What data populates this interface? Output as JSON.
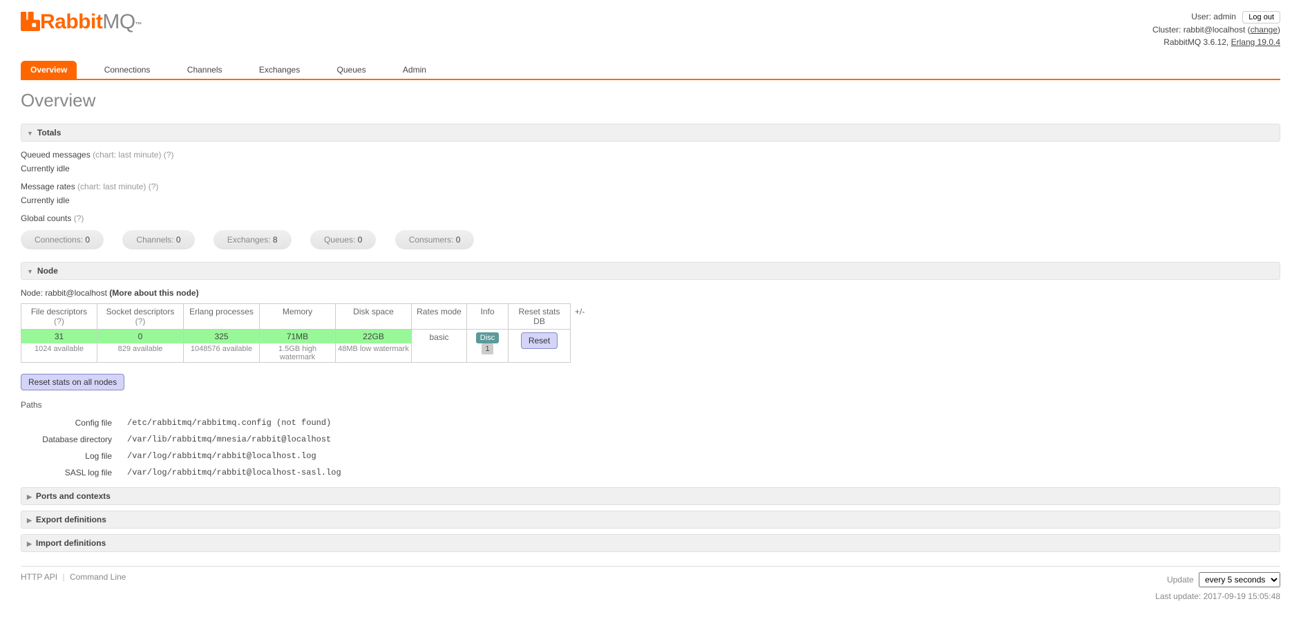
{
  "header": {
    "logo_rabbit": "Rabbit",
    "logo_mq": "MQ",
    "logo_tm": "™",
    "user_label": "User:",
    "user_name": "admin",
    "logout": "Log out",
    "cluster_label": "Cluster:",
    "cluster_name": "rabbit@localhost",
    "change": "change",
    "version": "RabbitMQ 3.6.12,",
    "erlang": "Erlang 19.0.4"
  },
  "nav": {
    "tabs": [
      {
        "label": "Overview",
        "active": true
      },
      {
        "label": "Connections",
        "active": false
      },
      {
        "label": "Channels",
        "active": false
      },
      {
        "label": "Exchanges",
        "active": false
      },
      {
        "label": "Queues",
        "active": false
      },
      {
        "label": "Admin",
        "active": false
      }
    ]
  },
  "page_title": "Overview",
  "totals": {
    "header": "Totals",
    "queued_label": "Queued messages",
    "queued_meta": "(chart: last minute)",
    "help": "(?)",
    "idle1": "Currently idle",
    "rates_label": "Message rates",
    "rates_meta": "(chart: last minute)",
    "idle2": "Currently idle",
    "global_label": "Global counts",
    "counts": [
      {
        "label": "Connections:",
        "value": "0"
      },
      {
        "label": "Channels:",
        "value": "0"
      },
      {
        "label": "Exchanges:",
        "value": "8"
      },
      {
        "label": "Queues:",
        "value": "0"
      },
      {
        "label": "Consumers:",
        "value": "0"
      }
    ]
  },
  "node": {
    "header": "Node",
    "node_label": "Node:",
    "node_name": "rabbit@localhost",
    "more": "(More about this node)",
    "plus_minus": "+/-",
    "columns": [
      "File descriptors",
      "Socket descriptors",
      "Erlang processes",
      "Memory",
      "Disk space",
      "Rates mode",
      "Info",
      "Reset stats DB"
    ],
    "fd": {
      "value": "31",
      "sub": "1024 available"
    },
    "sd": {
      "value": "0",
      "sub": "829 available"
    },
    "ep": {
      "value": "325",
      "sub": "1048576 available"
    },
    "mem": {
      "value": "71MB",
      "sub": "1.5GB high watermark"
    },
    "disk": {
      "value": "22GB",
      "sub": "48MB low watermark"
    },
    "rates_mode": "basic",
    "info_tag": "Disc",
    "info_num": "1",
    "reset_btn": "Reset",
    "reset_all": "Reset stats on all nodes"
  },
  "paths": {
    "header": "Paths",
    "rows": [
      {
        "label": "Config file",
        "value": "/etc/rabbitmq/rabbitmq.config (not found)"
      },
      {
        "label": "Database directory",
        "value": "/var/lib/rabbitmq/mnesia/rabbit@localhost"
      },
      {
        "label": "Log file",
        "value": "/var/log/rabbitmq/rabbit@localhost.log"
      },
      {
        "label": "SASL log file",
        "value": "/var/log/rabbitmq/rabbit@localhost-sasl.log"
      }
    ]
  },
  "collapsed": {
    "ports": "Ports and contexts",
    "export": "Export definitions",
    "import": "Import definitions"
  },
  "footer": {
    "http_api": "HTTP API",
    "cmd_line": "Command Line",
    "update_label": "Update",
    "update_options": [
      "every 5 seconds"
    ],
    "last_update_label": "Last update:",
    "last_update_value": "2017-09-19 15:05:48"
  }
}
